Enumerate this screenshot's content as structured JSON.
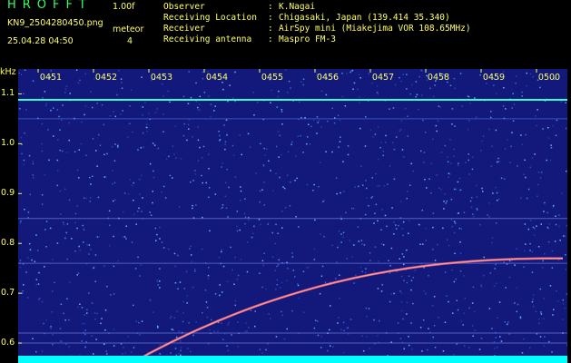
{
  "app": {
    "title": "HROFFT",
    "version": "1.00f",
    "filename": "KN9_2504280450.png",
    "datetime": "25.04.28 04:50",
    "mode_label": "meteor",
    "mode_value": "4"
  },
  "info": [
    {
      "key": "Observer",
      "value": "K.Nagai"
    },
    {
      "key": "Receiving Location",
      "value": "Chigasaki, Japan (139.414 35.340)"
    },
    {
      "key": "Receiver",
      "value": "AirSpy mini (Miakejima VOR 108.65MHz)"
    },
    {
      "key": "Receiving antenna",
      "value": "Maspro FM-3"
    }
  ],
  "spectrogram": {
    "unit": "kHz",
    "freq_range_khz": [
      0.56,
      1.15
    ],
    "freq_ticks": [
      "1.1",
      "1.0",
      "0.9",
      "0.8",
      "0.7",
      "0.6"
    ],
    "time_ticks": [
      "0451",
      "0452",
      "0453",
      "0454",
      "0455",
      "0456",
      "0457",
      "0458",
      "0459",
      "0500"
    ],
    "colors": {
      "background": "#12197a",
      "carrier": "#33ffcc",
      "meteor_trail": "#ff6699",
      "noise_floor": "#00ffff",
      "axis_text": "#ffff66"
    }
  }
}
